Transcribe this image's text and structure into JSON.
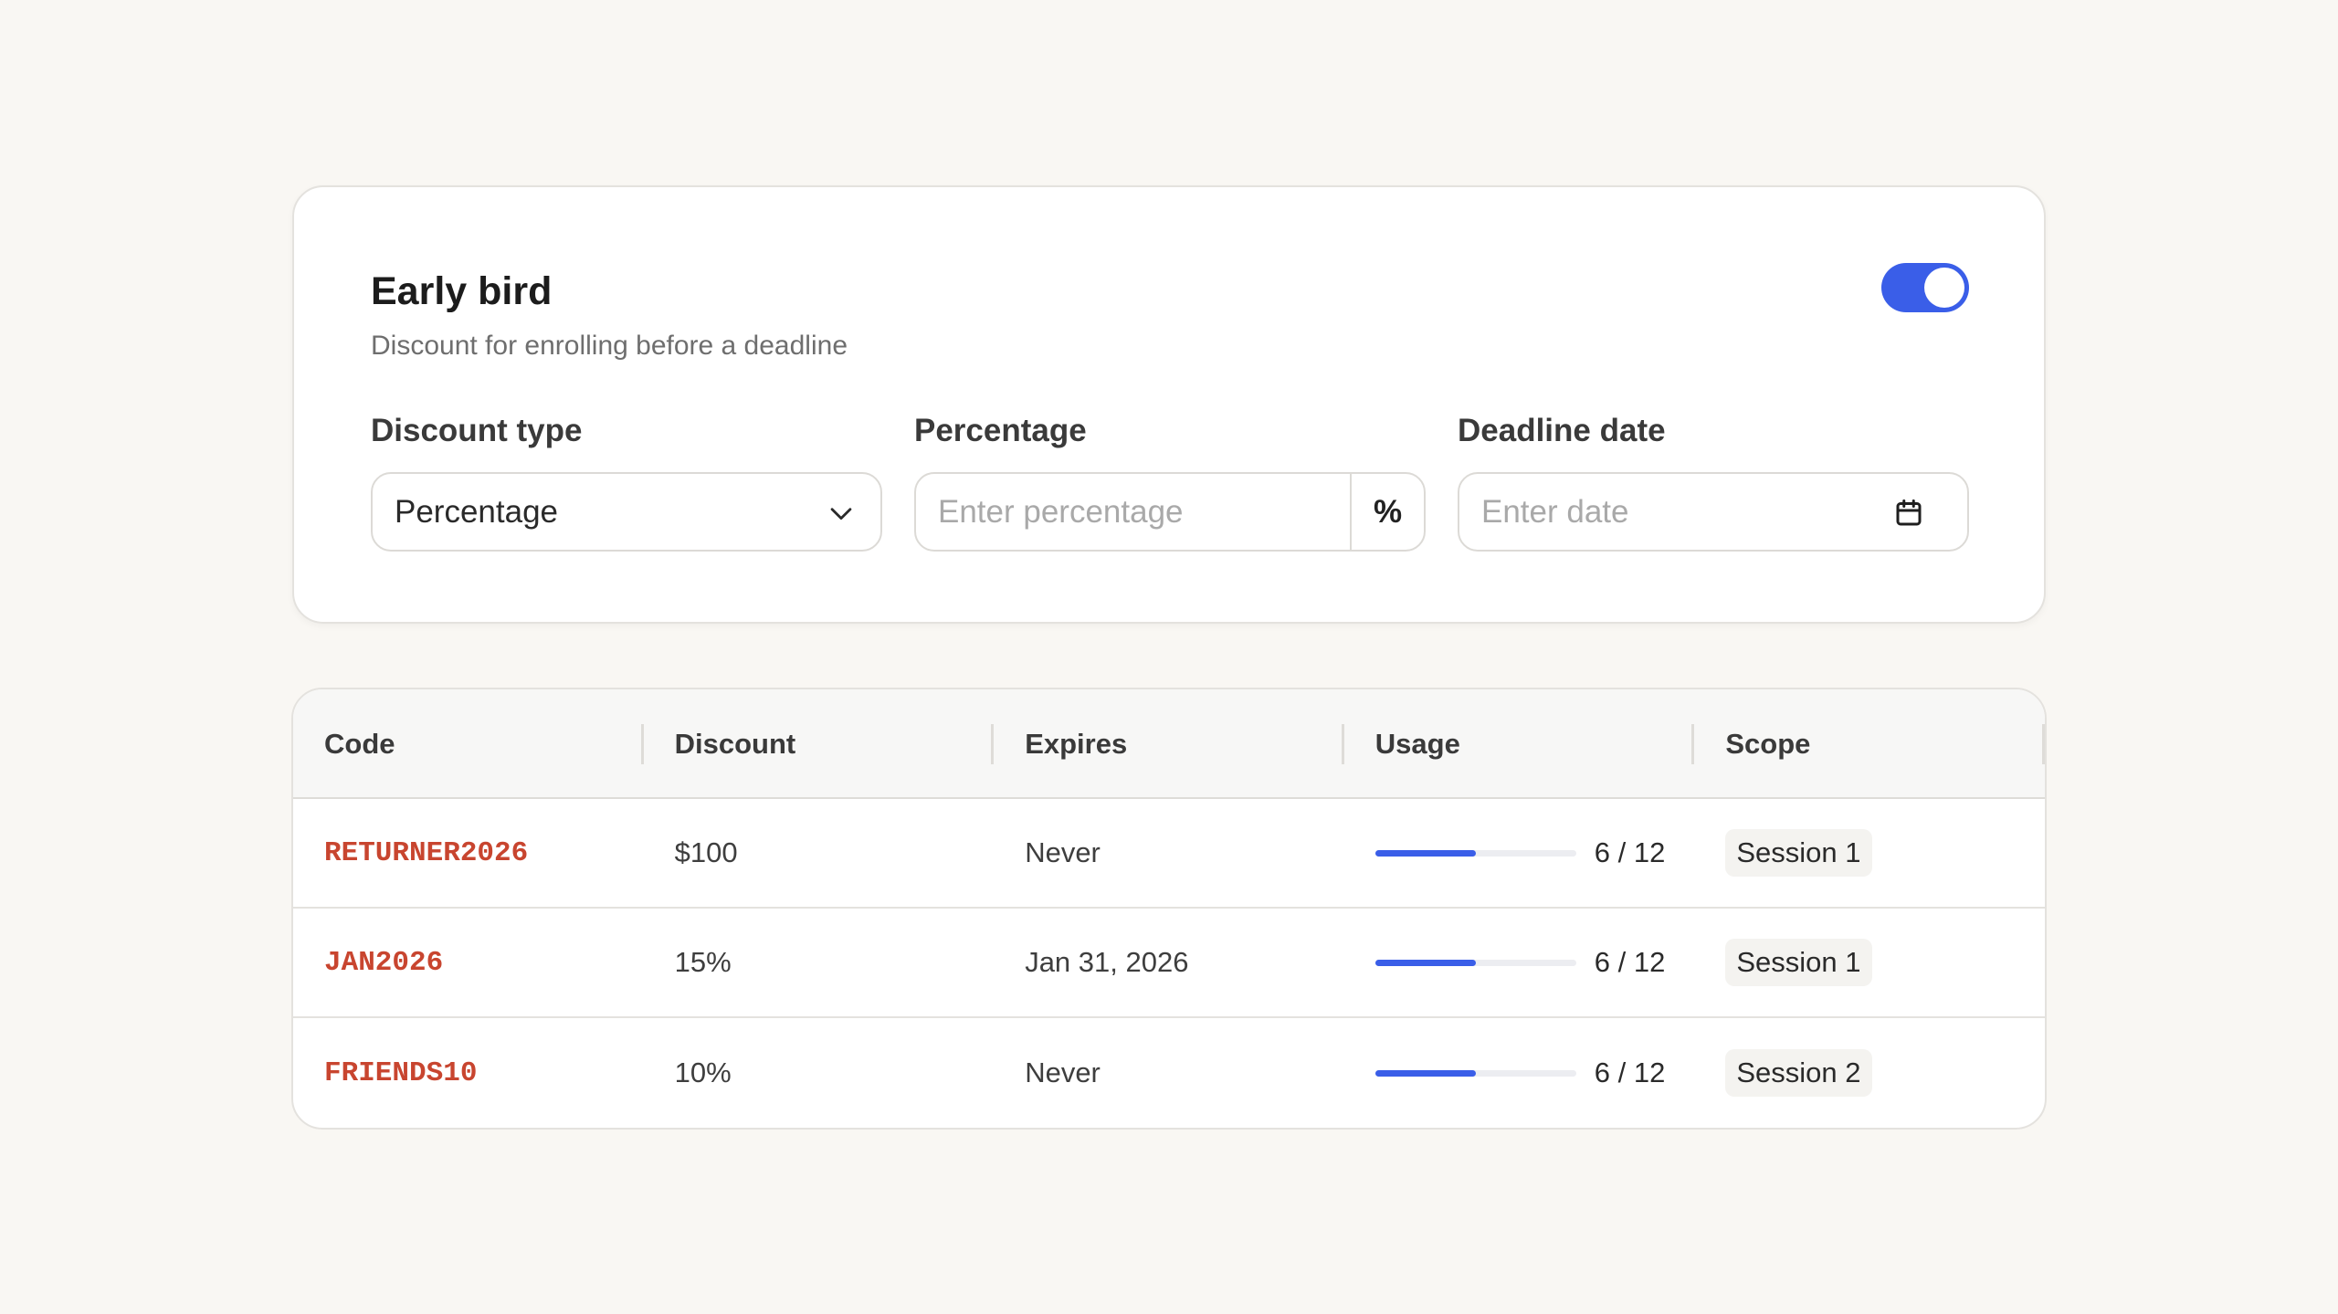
{
  "settings": {
    "title": "Early bird",
    "subtitle": "Discount for enrolling before a deadline",
    "enabled": true,
    "accent_color": "#3a5ee8",
    "fields": {
      "discount_type": {
        "label": "Discount type",
        "value": "Percentage"
      },
      "percentage": {
        "label": "Percentage",
        "placeholder": "Enter percentage",
        "suffix": "%"
      },
      "deadline": {
        "label": "Deadline date",
        "placeholder": "Enter date"
      }
    }
  },
  "table": {
    "headers": [
      "Code",
      "Discount",
      "Expires",
      "Usage",
      "Scope"
    ],
    "rows": [
      {
        "code": "RETURNER2026",
        "discount": "$100",
        "expires": "Never",
        "usage": "6 / 12",
        "usage_fraction": 0.5,
        "scope": "Session 1"
      },
      {
        "code": "JAN2026",
        "discount": "15%",
        "expires": "Jan 31, 2026",
        "usage": "6 / 12",
        "usage_fraction": 0.5,
        "scope": "Session 1"
      },
      {
        "code": "FRIENDS10",
        "discount": "10%",
        "expires": "Never",
        "usage": "6 / 12",
        "usage_fraction": 0.5,
        "scope": "Session 2"
      }
    ],
    "code_color": "#c8452f"
  }
}
